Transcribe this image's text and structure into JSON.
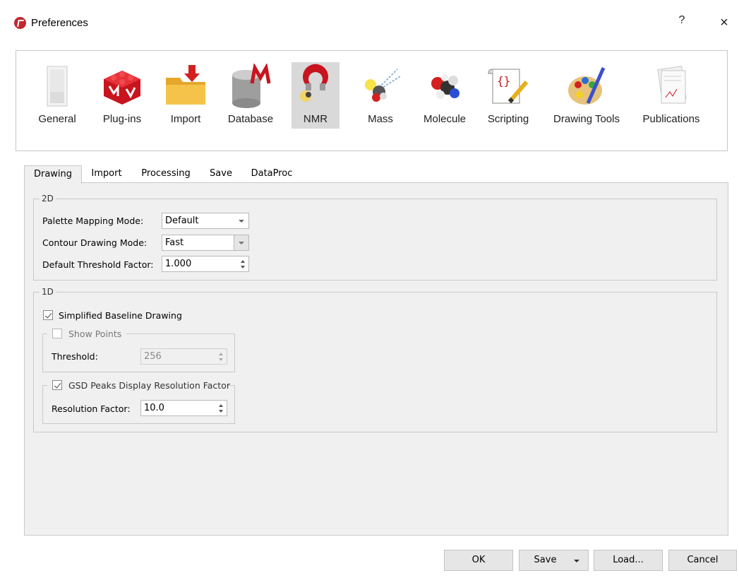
{
  "window": {
    "title": "Preferences",
    "help": "?",
    "close": "×"
  },
  "toolbar": {
    "active": "NMR",
    "items": [
      {
        "label": "General",
        "icon": "general-icon"
      },
      {
        "label": "Plug-ins",
        "icon": "plugins-icon"
      },
      {
        "label": "Import",
        "icon": "import-icon"
      },
      {
        "label": "Database",
        "icon": "database-icon"
      },
      {
        "label": "NMR",
        "icon": "nmr-icon"
      },
      {
        "label": "Mass",
        "icon": "mass-icon"
      },
      {
        "label": "Molecule",
        "icon": "molecule-icon"
      },
      {
        "label": "Scripting",
        "icon": "scripting-icon"
      },
      {
        "label": "Drawing Tools",
        "icon": "drawing-tools-icon"
      },
      {
        "label": "Publications",
        "icon": "publications-icon"
      }
    ]
  },
  "tabs": [
    "Drawing",
    "Import",
    "Processing",
    "Save",
    "DataProc"
  ],
  "section2d": {
    "title": "2D",
    "palette_label": "Palette Mapping Mode:",
    "palette_value": "Default",
    "contour_label": "Contour Drawing Mode:",
    "contour_value": "Fast",
    "threshold_label": "Default Threshold Factor:",
    "threshold_value": "1.000"
  },
  "section1d": {
    "title": "1D",
    "simplified_label": "Simplified Baseline Drawing",
    "simplified_checked": true,
    "show_points_label": "Show Points",
    "show_points_checked": false,
    "threshold_label": "Threshold:",
    "threshold_value": "256",
    "gsd_label": "GSD Peaks Display Resolution Factor",
    "gsd_checked": true,
    "resolution_label": "Resolution Factor:",
    "resolution_value": "10.0"
  },
  "buttons": {
    "ok": "OK",
    "save": "Save",
    "load": "Load...",
    "cancel": "Cancel"
  }
}
